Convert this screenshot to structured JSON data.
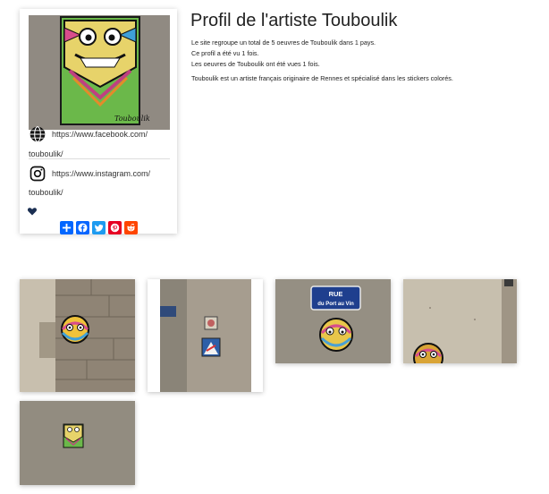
{
  "profile": {
    "title": "Profil de l'artiste Touboulik",
    "info_lines": [
      "Le site regroupe un total de 5 oeuvres de Touboulik dans 1 pays.",
      "Ce profil a été vu 1 fois.",
      "Les oeuvres de Touboulik ont été vues 1 fois."
    ],
    "bio": "Touboulik est un artiste français originaire de Rennes et spécialisé dans les stickers colorés.",
    "signature": "Touboulik"
  },
  "links": {
    "facebook_part1": "https://www.facebook.com/",
    "facebook_part2": "touboulik/",
    "instagram_part1": "https://www.instagram.com/",
    "instagram_part2": "touboulik/"
  },
  "icons": {
    "website": "globe-icon",
    "instagram": "instagram-icon",
    "like": "heart-icon",
    "share": [
      "plus-icon",
      "facebook-icon",
      "twitter-icon",
      "pinterest-icon",
      "reddit-icon"
    ]
  },
  "share_colors": [
    "#0166ff",
    "#0866ff",
    "#1d9bf0",
    "#e60023",
    "#ff4500"
  ],
  "gallery": {
    "street_sign": {
      "line1": "RUE",
      "line2": "du Port au Vin"
    }
  }
}
